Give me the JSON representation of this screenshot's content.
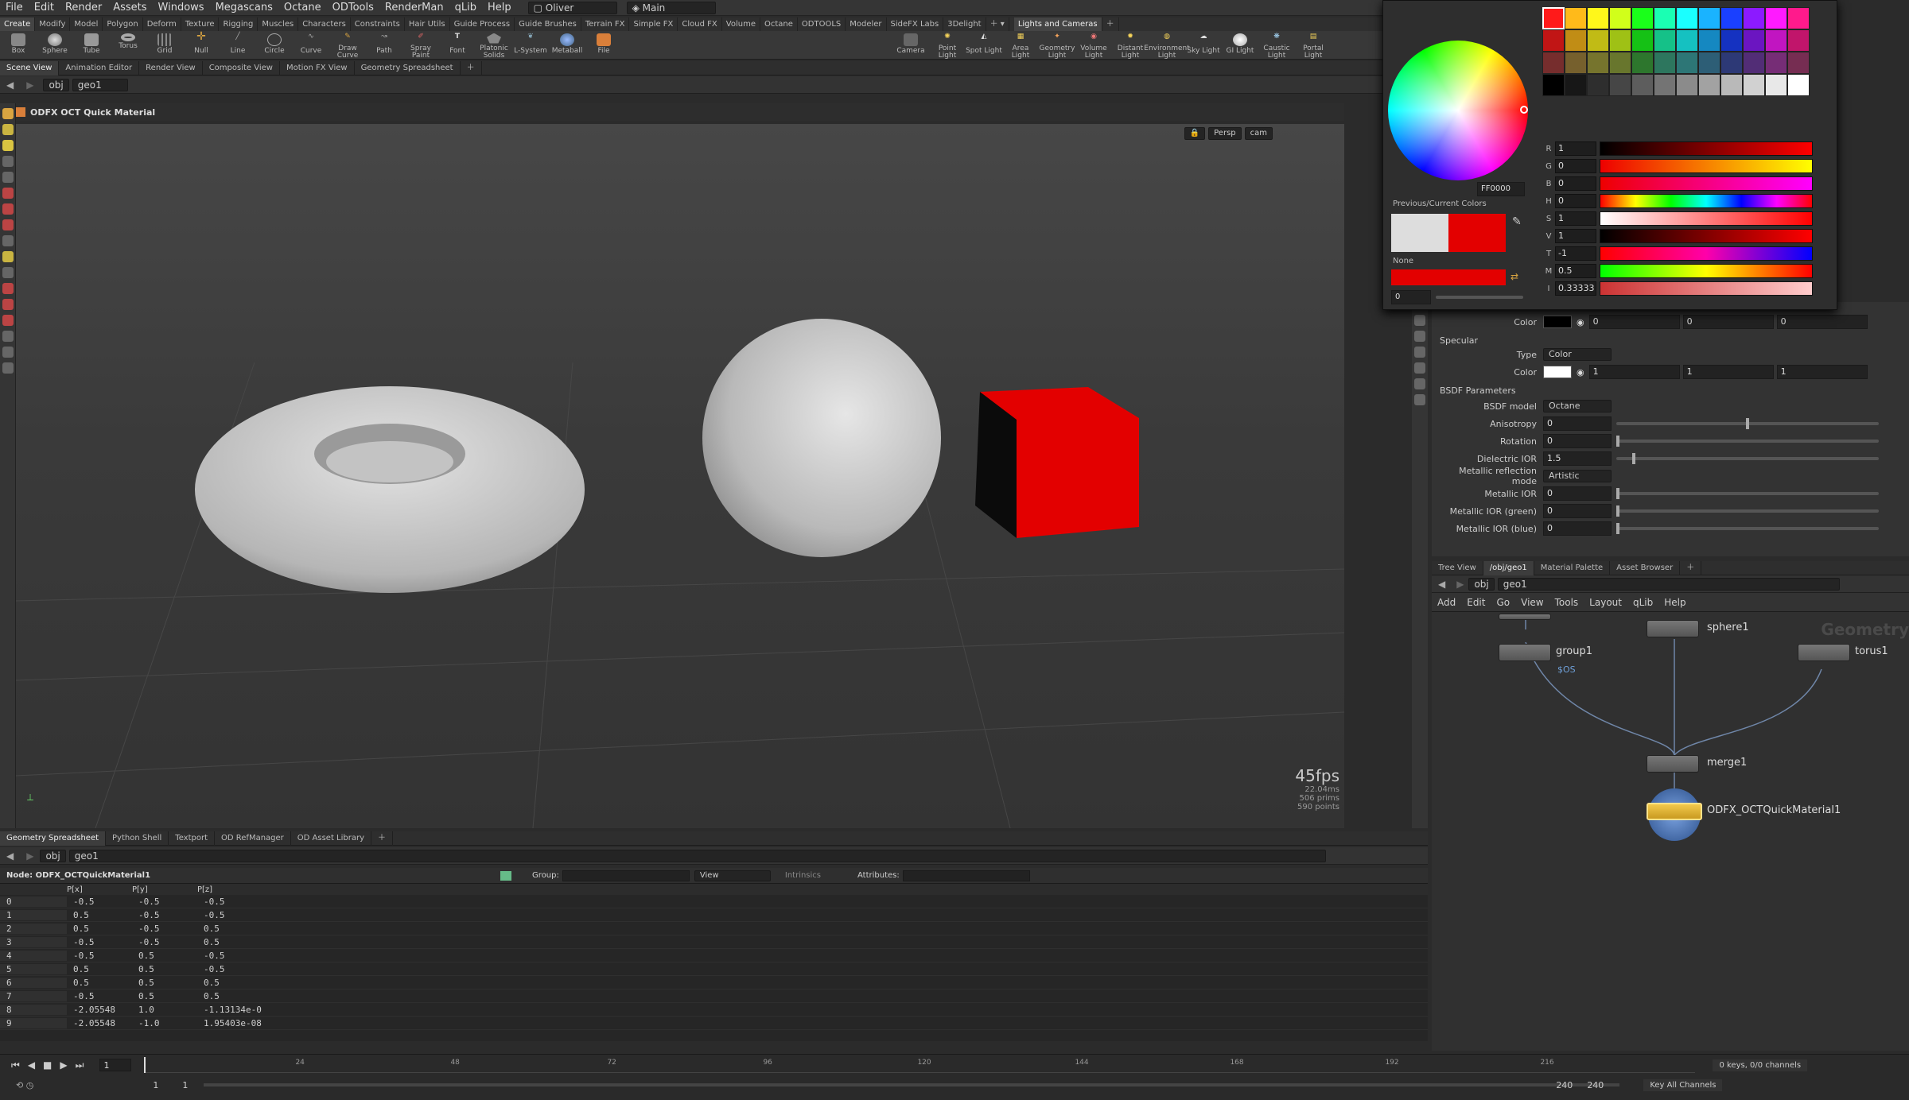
{
  "menu": {
    "items": [
      "File",
      "Edit",
      "Render",
      "Assets",
      "Windows",
      "Megascans",
      "Octane",
      "ODTools",
      "RenderMan",
      "qLib",
      "Help"
    ],
    "desktop": "Oliver",
    "context": "Main"
  },
  "shelf_tabs": [
    "Create",
    "Modify",
    "Model",
    "Polygon",
    "Deform",
    "Texture",
    "Rigging",
    "Muscles",
    "Characters",
    "Constraints",
    "Hair Utils",
    "Guide Process",
    "Guide Brushes",
    "Terrain FX",
    "Simple FX",
    "Cloud FX",
    "Volume",
    "Octane",
    "ODTOOLS",
    "Modeler",
    "SideFX Labs",
    "3Delight"
  ],
  "shelf_tabs2": [
    "Lights and Cameras"
  ],
  "tools1": [
    "Box",
    "Sphere",
    "Tube",
    "Torus",
    "Grid",
    "Null",
    "Line",
    "Circle",
    "Curve",
    "Draw Curve",
    "Path",
    "Spray Paint",
    "Font",
    "Platonic Solids",
    "L-System",
    "Metaball",
    "File"
  ],
  "tools2": [
    "Camera",
    "Point Light",
    "Spot Light",
    "Area Light",
    "Geometry Light",
    "Volume Light",
    "Distant Light",
    "Environment Light",
    "Sky Light",
    "GI Light",
    "Caustic Light",
    "Portal Light"
  ],
  "view_tabs": [
    "Scene View",
    "Animation Editor",
    "Render View",
    "Composite View",
    "Motion FX View",
    "Geometry Spreadsheet"
  ],
  "path": {
    "obj": "obj",
    "geo": "geo1"
  },
  "viewport": {
    "title": "ODFX OCT Quick Material",
    "persp": "Persp",
    "cam": "cam",
    "fps": "45fps",
    "time": "22.04ms",
    "prims": "506  prims",
    "points": "590 points"
  },
  "bottom_tabs": [
    "Geometry Spreadsheet",
    "Python Shell",
    "Textport",
    "OD RefManager",
    "OD Asset Library"
  ],
  "sheet": {
    "node": "Node: ODFX_OCTQuickMaterial1",
    "group_label": "Group:",
    "view": "View",
    "intrinsics": "Intrinsics",
    "attributes": "Attributes:",
    "headers": [
      "P[x]",
      "P[y]",
      "P[z]"
    ],
    "rows": [
      [
        "0",
        "-0.5",
        "-0.5",
        "-0.5"
      ],
      [
        "1",
        "0.5",
        "-0.5",
        "-0.5"
      ],
      [
        "2",
        "0.5",
        "-0.5",
        "0.5"
      ],
      [
        "3",
        "-0.5",
        "-0.5",
        "0.5"
      ],
      [
        "4",
        "-0.5",
        "0.5",
        "-0.5"
      ],
      [
        "5",
        "0.5",
        "0.5",
        "-0.5"
      ],
      [
        "6",
        "0.5",
        "0.5",
        "0.5"
      ],
      [
        "7",
        "-0.5",
        "0.5",
        "0.5"
      ],
      [
        "8",
        "-2.05548",
        "1.0",
        "-1.13134e-0"
      ],
      [
        "9",
        "-2.05548",
        "-1.0",
        "1.95403e-08"
      ]
    ]
  },
  "timeline": {
    "frame": "1",
    "start": "1",
    "start2": "1",
    "end": "240",
    "end2": "240",
    "ticks": [
      "24",
      "48",
      "72",
      "96",
      "120",
      "144",
      "168",
      "192",
      "216"
    ],
    "keys": "0 keys, 0/0 channels",
    "key_all": "Key All Channels"
  },
  "colorpicker": {
    "hex": "FF0000",
    "prev_label": "Previous/Current Colors",
    "none_label": "None",
    "alpha": "0",
    "channels": [
      {
        "label": "R",
        "value": "1"
      },
      {
        "label": "G",
        "value": "0"
      },
      {
        "label": "B",
        "value": "0"
      },
      {
        "label": "H",
        "value": "0"
      },
      {
        "label": "S",
        "value": "1"
      },
      {
        "label": "V",
        "value": "1"
      },
      {
        "label": "T",
        "value": "-1"
      },
      {
        "label": "M",
        "value": "0.5"
      },
      {
        "label": "I",
        "value": "0.33333"
      }
    ]
  },
  "params": {
    "diffuse_color_label": "Color",
    "diffuse_vals": [
      "0",
      "0",
      "0"
    ],
    "specular_header": "Specular",
    "type_label": "Type",
    "type_value": "Color",
    "spec_color_label": "Color",
    "spec_vals": [
      "1",
      "1",
      "1"
    ],
    "bsdf_header": "BSDF Parameters",
    "rows": [
      {
        "label": "BSDF model",
        "value": "Octane",
        "kind": "menu"
      },
      {
        "label": "Anisotropy",
        "value": "0",
        "kind": "slider",
        "pos": 0.5
      },
      {
        "label": "Rotation",
        "value": "0",
        "kind": "slider",
        "pos": 0.0
      },
      {
        "label": "Dielectric IOR",
        "value": "1.5",
        "kind": "slider",
        "pos": 0.06
      },
      {
        "label": "Metallic reflection mode",
        "value": "Artistic",
        "kind": "menu"
      },
      {
        "label": "Metallic IOR",
        "value": "0",
        "kind": "slider",
        "pos": 0.0
      },
      {
        "label": "Metallic IOR (green)",
        "value": "0",
        "kind": "slider",
        "pos": 0.0
      },
      {
        "label": "Metallic IOR (blue)",
        "value": "0",
        "kind": "slider",
        "pos": 0.0
      }
    ]
  },
  "network": {
    "tabs": [
      "Tree View",
      "/obj/geo1",
      "Material Palette",
      "Asset Browser"
    ],
    "menu": [
      "Add",
      "Edit",
      "Go",
      "View",
      "Tools",
      "Layout",
      "qLib",
      "Help"
    ],
    "watermark": "Geometry",
    "nodes": {
      "sphere": "sphere1",
      "torus": "torus1",
      "group": "group1",
      "group_sub": "$OS",
      "merge": "merge1",
      "material": "ODFX_OCTQuickMaterial1"
    }
  },
  "colors": {
    "red": "#e30000",
    "bg": "#2b2b2b",
    "accent": "#f2c94c"
  }
}
